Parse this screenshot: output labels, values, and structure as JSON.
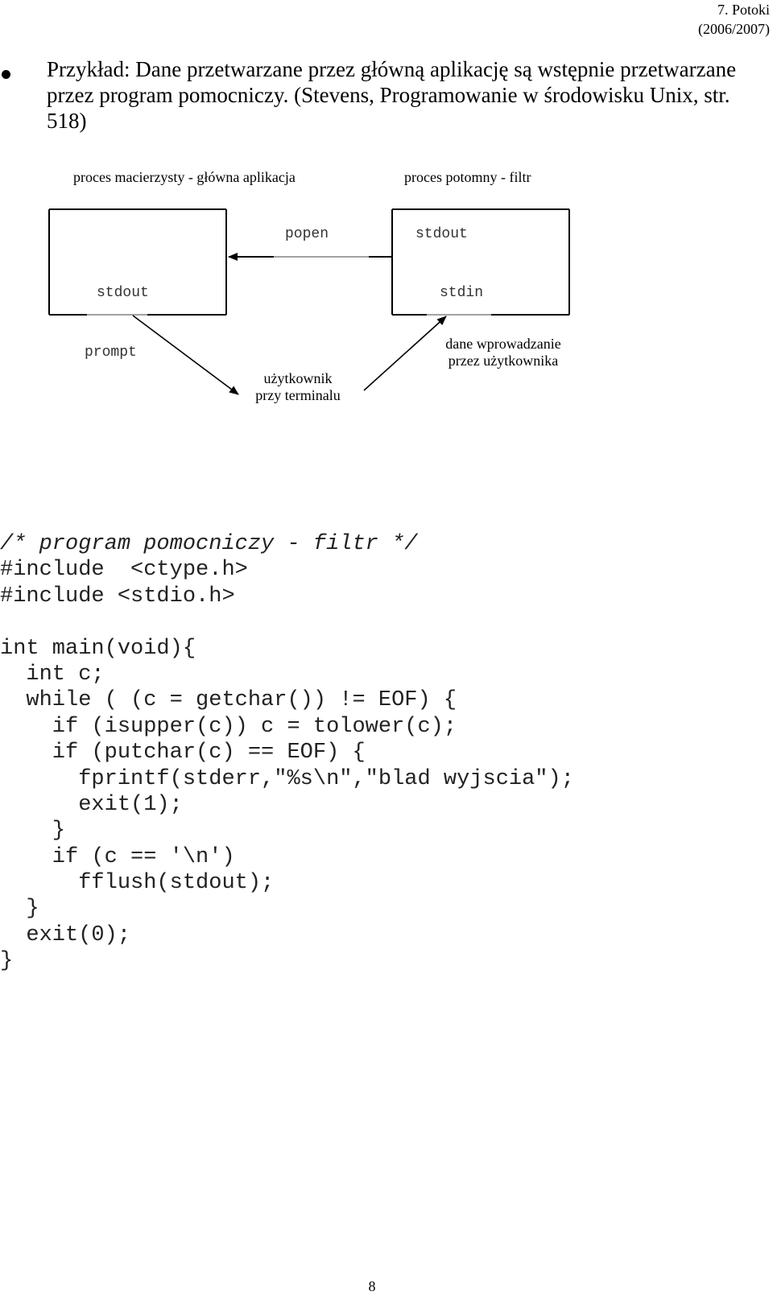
{
  "header": {
    "chapter": "7. Potoki",
    "year": "(2006/2007)"
  },
  "intro": {
    "text": "Przykład: Dane przetwarzane przez główną aplikację są wstępnie przetwarzane przez program pomocniczy. (Stevens, Programowanie w środowisku Unix, str. 518)"
  },
  "diagram": {
    "parent_title": "proces macierzysty - główna aplikacja",
    "child_title": "proces potomny - filtr",
    "parent_box": {
      "stream_label": "stdout"
    },
    "child_box": {
      "top_label": "stdout",
      "bottom_label": "stdin"
    },
    "pipe_label": "popen",
    "prompt_label": "prompt",
    "user_label_line1": "użytkownik",
    "user_label_line2": "przy terminalu",
    "input_label_line1": "dane wprowadzanie",
    "input_label_line2": "przez użytkownika"
  },
  "code": {
    "lines": [
      "/* program pomocniczy - filtr */",
      "#include  <ctype.h>",
      "#include <stdio.h>",
      "",
      "int main(void){",
      "  int c;",
      "  while ( (c = getchar()) != EOF) {",
      "    if (isupper(c)) c = tolower(c);",
      "    if (putchar(c) == EOF) {",
      "      fprintf(stderr,\"%s\\n\",\"blad wyjscia\");",
      "      exit(1);",
      "    }",
      "    if (c == '\\n')",
      "      fflush(stdout);",
      "  }",
      "  exit(0);",
      "}"
    ]
  },
  "footer": {
    "page_number": "8"
  }
}
